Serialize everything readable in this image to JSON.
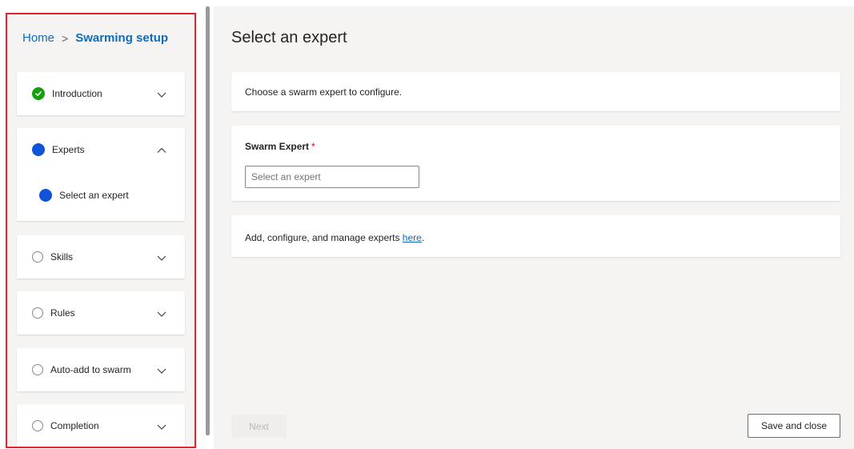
{
  "breadcrumb": {
    "home": "Home",
    "separator": ">",
    "current": "Swarming setup"
  },
  "steps": [
    {
      "label": "Introduction",
      "status": "complete",
      "expanded": false
    },
    {
      "label": "Experts",
      "status": "current",
      "expanded": true,
      "substeps": [
        {
          "label": "Select an expert",
          "status": "current"
        }
      ]
    },
    {
      "label": "Skills",
      "status": "not-started",
      "expanded": false
    },
    {
      "label": "Rules",
      "status": "not-started",
      "expanded": false
    },
    {
      "label": "Auto-add to swarm",
      "status": "not-started",
      "expanded": false
    },
    {
      "label": "Completion",
      "status": "not-started",
      "expanded": false
    }
  ],
  "main": {
    "title": "Select an expert",
    "instruction": "Choose a swarm expert to configure.",
    "field": {
      "label": "Swarm Expert",
      "required_marker": "*",
      "placeholder": "Select an expert"
    },
    "manage_text": "Add, configure, and manage experts ",
    "manage_link": "here",
    "manage_suffix": "."
  },
  "buttons": {
    "next": "Next",
    "save_close": "Save and close"
  },
  "colors": {
    "accent": "#0f6cbd",
    "complete": "#13a10e",
    "current": "#0f54d8",
    "highlight_border": "#e0232e"
  }
}
